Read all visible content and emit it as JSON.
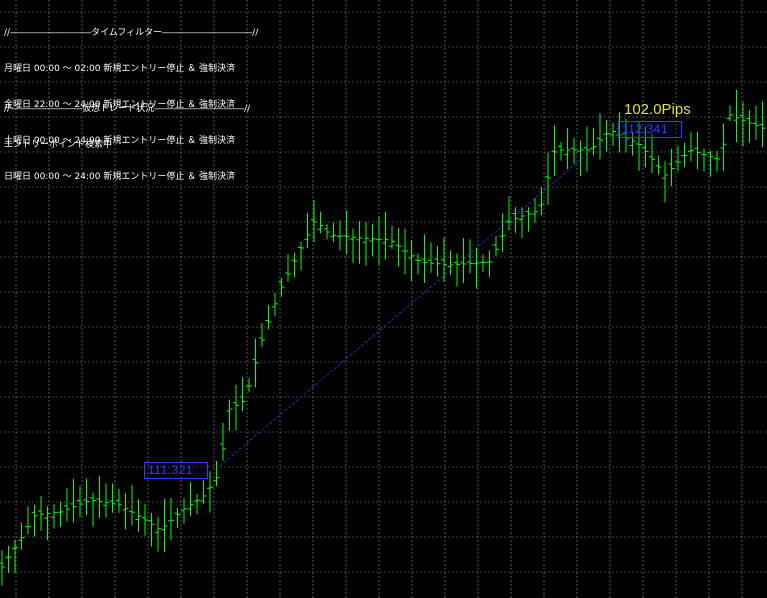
{
  "time_filter": {
    "header": "//―――――――――タイムフィルター――――――――――//",
    "rows": [
      "月曜日 00:00 ～ 02:00 新規エントリー停止 ＆ 強制決済",
      "金曜日 22:00 ～ 24:00 新規エントリー停止 ＆ 強制決済",
      "土曜日 00:00 ～ 24:00 新規エントリー停止 ＆ 強制決済",
      "日曜日 00:00 ～ 24:00 新規エントリー停止 ＆ 強制決済"
    ]
  },
  "virtual_trade": {
    "header": "//――――――――仮想トレード状況――――――――――//",
    "status": "エントリーポイント検索中"
  },
  "trade_result": {
    "pips_label": "102.0Pips",
    "entry_price": "111.321",
    "exit_price": "112.341"
  },
  "colors": {
    "background": "#000000",
    "bars": "#00ff00",
    "grid": "#8a8a8a",
    "trade_line": "#2030c0",
    "price_tag": "#3040ff",
    "pips_text": "#e0e040",
    "panel_text": "#ffffff"
  }
}
